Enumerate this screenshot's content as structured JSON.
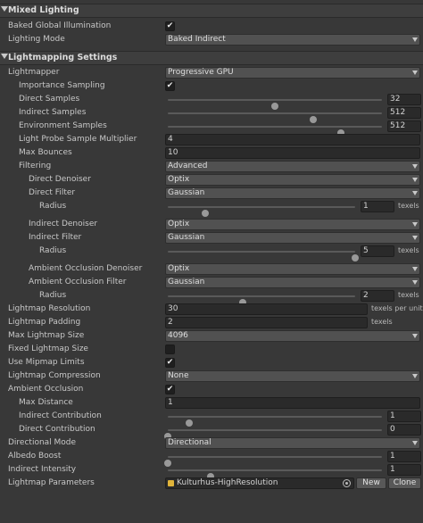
{
  "mixed_lighting": {
    "title": "Mixed Lighting",
    "baked_gi_label": "Baked Global Illumination",
    "baked_gi_checked": true,
    "lighting_mode_label": "Lighting Mode",
    "lighting_mode_value": "Baked Indirect"
  },
  "lightmapping": {
    "title": "Lightmapping Settings",
    "lightmapper_label": "Lightmapper",
    "lightmapper_value": "Progressive GPU",
    "importance_sampling_label": "Importance Sampling",
    "importance_sampling_checked": true,
    "direct_samples": {
      "label": "Direct Samples",
      "value": "32",
      "fraction": 0.5
    },
    "indirect_samples": {
      "label": "Indirect Samples",
      "value": "512",
      "fraction": 0.68
    },
    "environment_samples": {
      "label": "Environment Samples",
      "value": "512",
      "fraction": 0.81
    },
    "light_probe_multiplier": {
      "label": "Light Probe Sample Multiplier",
      "value": "4"
    },
    "max_bounces": {
      "label": "Max Bounces",
      "value": "10"
    },
    "filtering": {
      "label": "Filtering",
      "value": "Advanced"
    },
    "direct_denoiser": {
      "label": "Direct Denoiser",
      "value": "Optix"
    },
    "direct_filter": {
      "label": "Direct Filter",
      "value": "Gaussian"
    },
    "direct_radius": {
      "label": "Radius",
      "value": "1",
      "unit": "texels",
      "fraction": 0.2
    },
    "indirect_denoiser": {
      "label": "Indirect Denoiser",
      "value": "Optix"
    },
    "indirect_filter": {
      "label": "Indirect Filter",
      "value": "Gaussian"
    },
    "indirect_radius": {
      "label": "Radius",
      "value": "5",
      "unit": "texels",
      "fraction": 1.0
    },
    "ao_denoiser": {
      "label": "Ambient Occlusion Denoiser",
      "value": "Optix"
    },
    "ao_filter": {
      "label": "Ambient Occlusion Filter",
      "value": "Gaussian"
    },
    "ao_radius": {
      "label": "Radius",
      "value": "2",
      "unit": "texels",
      "fraction": 0.4
    },
    "lightmap_resolution": {
      "label": "Lightmap Resolution",
      "value": "30",
      "unit": "texels per unit"
    },
    "lightmap_padding": {
      "label": "Lightmap Padding",
      "value": "2",
      "unit": "texels"
    },
    "max_lightmap_size": {
      "label": "Max Lightmap Size",
      "value": "4096"
    },
    "fixed_lightmap_size": {
      "label": "Fixed Lightmap Size",
      "checked": false
    },
    "use_mipmap_limits": {
      "label": "Use Mipmap Limits",
      "checked": true
    },
    "lightmap_compression": {
      "label": "Lightmap Compression",
      "value": "None"
    },
    "ambient_occlusion": {
      "label": "Ambient Occlusion",
      "checked": true
    },
    "max_distance": {
      "label": "Max Distance",
      "value": "1"
    },
    "indirect_contribution": {
      "label": "Indirect Contribution",
      "value": "1",
      "fraction": 0.1
    },
    "direct_contribution": {
      "label": "Direct Contribution",
      "value": "0",
      "fraction": 0.0
    },
    "directional_mode": {
      "label": "Directional Mode",
      "value": "Directional"
    },
    "albedo_boost": {
      "label": "Albedo Boost",
      "value": "1",
      "fraction": 0.0
    },
    "indirect_intensity": {
      "label": "Indirect Intensity",
      "value": "1",
      "fraction": 0.2
    },
    "lightmap_parameters": {
      "label": "Lightmap Parameters",
      "value": "Kulturhus-HighResolution",
      "new_label": "New",
      "clone_label": "Clone"
    }
  },
  "check_glyph": "✔"
}
